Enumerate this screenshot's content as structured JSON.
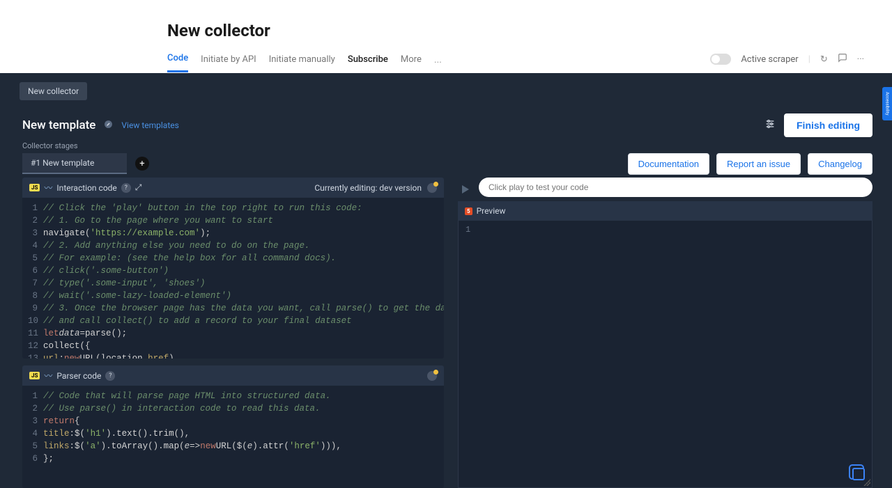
{
  "header": {
    "title": "New collector",
    "tabs": [
      "Code",
      "Initiate by API",
      "Initiate manually",
      "Subscribe",
      "More"
    ],
    "active_tab_index": 0,
    "dark_tab_index": 3,
    "active_scraper_label": "Active scraper"
  },
  "chip": {
    "label": "New collector"
  },
  "template": {
    "title": "New template",
    "view_templates": "View templates",
    "finish_label": "Finish editing"
  },
  "stages": {
    "label": "Collector stages",
    "item": "#1 New template"
  },
  "doc_buttons": [
    "Documentation",
    "Report an issue",
    "Changelog"
  ],
  "interaction": {
    "title": "Interaction code",
    "editing": "Currently editing: dev version"
  },
  "parser": {
    "title": "Parser code"
  },
  "preview": {
    "play_placeholder": "Click play to test your code",
    "label": "Preview",
    "line1": "1"
  },
  "accessibility_label": "Accessibility"
}
